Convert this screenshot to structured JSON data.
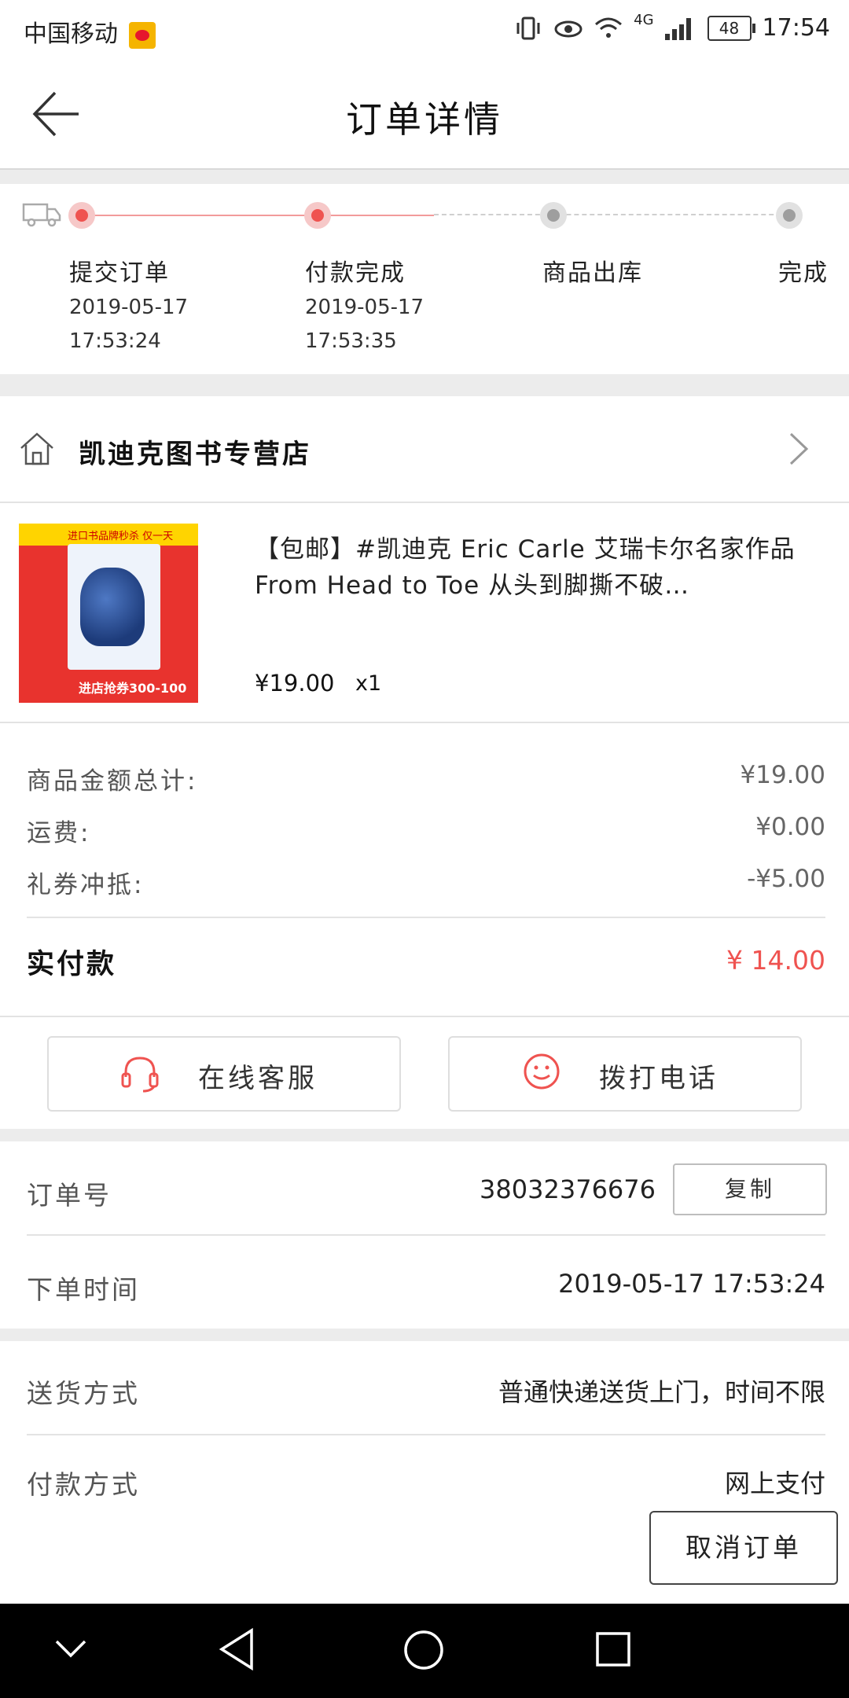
{
  "status_bar": {
    "carrier": "中国移动",
    "network": "4G",
    "battery": "48",
    "time": "17:54"
  },
  "header": {
    "title": "订单详情"
  },
  "progress": {
    "steps": [
      {
        "label": "提交订单",
        "date": "2019-05-17",
        "time": "17:53:24",
        "state": "active"
      },
      {
        "label": "付款完成",
        "date": "2019-05-17",
        "time": "17:53:35",
        "state": "active"
      },
      {
        "label": "商品出库",
        "date": "",
        "time": "",
        "state": "inactive"
      },
      {
        "label": "完成",
        "date": "",
        "time": "",
        "state": "inactive"
      }
    ]
  },
  "store": {
    "name": "凯迪克图书专营店"
  },
  "product": {
    "title": "【包邮】#凯迪克 Eric Carle 艾瑞卡尔名家作品 From Head to Toe 从头到脚撕不破…",
    "price": "¥19.00",
    "qty": "x1",
    "thumb_banner": "进口书品牌秒杀 仅一天",
    "thumb_promo": "进店抢券300-100"
  },
  "totals": {
    "goods_label": "商品金额总计:",
    "goods_value": "¥19.00",
    "shipping_label": "运费:",
    "shipping_value": "¥0.00",
    "coupon_label": "礼券冲抵:",
    "coupon_value": "-¥5.00",
    "paid_label": "实付款",
    "paid_value": "¥ 14.00"
  },
  "contact": {
    "online_service": "在线客服",
    "call_phone": "拨打电话"
  },
  "order_info": {
    "order_no_label": "订单号",
    "order_no_value": "38032376676",
    "copy_label": "复制",
    "order_time_label": "下单时间",
    "order_time_value": "2019-05-17 17:53:24",
    "delivery_label": "送货方式",
    "delivery_value": "普通快递送货上门，时间不限",
    "payment_label": "付款方式",
    "payment_value": "网上支付"
  },
  "actions": {
    "cancel_order": "取消订单"
  },
  "colors": {
    "accent": "#ef5350",
    "divider": "#e3e3e3",
    "background_gap": "#ececec"
  }
}
